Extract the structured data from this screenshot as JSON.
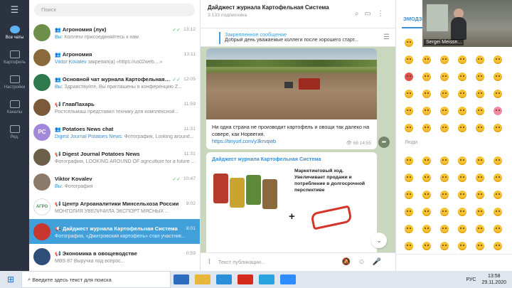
{
  "folders": {
    "menu_icon": "menu-icon",
    "items": [
      {
        "label": "Все чаты",
        "icon": "chat-bubble-icon",
        "active": true
      },
      {
        "label": "Картофель",
        "icon": "folder-icon"
      },
      {
        "label": "Настройки",
        "icon": "folder-icon"
      },
      {
        "label": "Каналы",
        "icon": "folder-icon"
      },
      {
        "label": "Ред.",
        "icon": "sliders-icon"
      }
    ]
  },
  "search": {
    "placeholder": "Поиск"
  },
  "chats": [
    {
      "name": "Агрономия (лук)",
      "time": "13:12",
      "sender": "Вы:",
      "preview": " Коллеги присоединяйтесь к нам",
      "color": "#6e8f4a",
      "check": "✓✓",
      "prefix": "👥"
    },
    {
      "name": "Агрономия",
      "time": "13:11",
      "sender": "Viktor Kovalev",
      "preview": " закрепил(а) «https://us02web....»",
      "color": "#8a6a3c",
      "prefix": "👥"
    },
    {
      "name": "Основной чат журнала Картофельная система",
      "time": "12:05",
      "sender": "Вы:",
      "preview": " Здравствуйте,  Вы приглашены в конференцию Z...",
      "color": "#2e7a4e",
      "check": "✓✓",
      "prefix": "👥"
    },
    {
      "name": "ГлавПахарь",
      "time": "11:59",
      "sender": "",
      "preview": "Ростсельмаш представил технику для комплексной...",
      "color": "#7a5a3a",
      "prefix": "📢"
    },
    {
      "name": "Potatoes News chat",
      "time": "11:31",
      "sender": "Digest Journal Potatoes News:",
      "preview": " Фотография, Looking around...",
      "color": "#a188d8",
      "initials": "PC",
      "prefix": "👥"
    },
    {
      "name": "Digest Journal Potatoes News",
      "time": "11:31",
      "sender": "",
      "preview": "Фотография, LOOKING AROUND OF agriculture for a future ...",
      "color": "#6c6048",
      "prefix": "📢"
    },
    {
      "name": "Viktor Kovalev",
      "time": "10:47",
      "sender": "Вы:",
      "preview": " Фотография",
      "color": "#8b7a6a",
      "check": "✓✓",
      "prefix": ""
    },
    {
      "name": "Центр Агроаналитики Минсельхоза России",
      "time": "9:02",
      "sender": "",
      "preview": "МОНГОЛИЯ УВЕЛИЧИЛА ЭКСПОРТ МЯСНЫХ ...",
      "color": "#ffffff",
      "initials": "АГРО",
      "prefix": "📢"
    },
    {
      "name": "Дайджест журнала Картофельная Система",
      "time": "8:01",
      "sender": "",
      "preview": "Фотография, «Дмитровский картофель» стал участник...",
      "color": "#c8362e",
      "prefix": "📢",
      "active": true
    },
    {
      "name": "Экономика в овощеводстве",
      "time": "0:59",
      "sender": "",
      "preview": "MBS 87 Выручка под вопрос...",
      "color": "#2f4f7a",
      "prefix": "📢"
    }
  ],
  "conversation": {
    "title": "Дайджест журнала Картофельная Система",
    "subtitle": "3 133 подписчика",
    "pin_label": "Закрепленное сообщение",
    "pin_text": "Добрый день уважаемые коллеги после хорошего старт...",
    "msg1": {
      "text": "Ни одна страна не производит картофель и овощи так далеко на совере, как Норвегия.",
      "link": "https://tinyurl.com/y3krvqwb",
      "views": "68",
      "time": "14:55"
    },
    "msg2": {
      "title": "Дайджест журнала Картофельная Система",
      "marketing": "Маркетинговый ход. Увеличивает продажи и потребление в долгосрочной перспективе",
      "plus": "+"
    },
    "input_placeholder": "Текст публикации..."
  },
  "emoji_panel": {
    "tab": "ЭМОДЗИ",
    "section": "Люди"
  },
  "video": {
    "name": "Sergei Meissn..."
  },
  "zoom_logo": "zoom",
  "taskbar": {
    "search": "Введите здесь текст для поиска",
    "lang": "РУС",
    "time": "13:58",
    "date": "29.11.2020"
  }
}
